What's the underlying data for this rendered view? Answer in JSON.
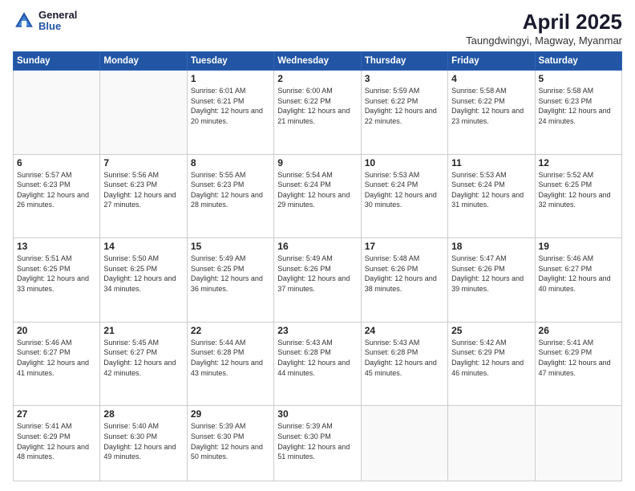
{
  "header": {
    "logo_general": "General",
    "logo_blue": "Blue",
    "title": "April 2025",
    "location": "Taungdwingyi, Magway, Myanmar"
  },
  "weekdays": [
    "Sunday",
    "Monday",
    "Tuesday",
    "Wednesday",
    "Thursday",
    "Friday",
    "Saturday"
  ],
  "weeks": [
    [
      {
        "day": "",
        "sunrise": "",
        "sunset": "",
        "daylight": ""
      },
      {
        "day": "",
        "sunrise": "",
        "sunset": "",
        "daylight": ""
      },
      {
        "day": "1",
        "sunrise": "Sunrise: 6:01 AM",
        "sunset": "Sunset: 6:21 PM",
        "daylight": "Daylight: 12 hours and 20 minutes."
      },
      {
        "day": "2",
        "sunrise": "Sunrise: 6:00 AM",
        "sunset": "Sunset: 6:22 PM",
        "daylight": "Daylight: 12 hours and 21 minutes."
      },
      {
        "day": "3",
        "sunrise": "Sunrise: 5:59 AM",
        "sunset": "Sunset: 6:22 PM",
        "daylight": "Daylight: 12 hours and 22 minutes."
      },
      {
        "day": "4",
        "sunrise": "Sunrise: 5:58 AM",
        "sunset": "Sunset: 6:22 PM",
        "daylight": "Daylight: 12 hours and 23 minutes."
      },
      {
        "day": "5",
        "sunrise": "Sunrise: 5:58 AM",
        "sunset": "Sunset: 6:23 PM",
        "daylight": "Daylight: 12 hours and 24 minutes."
      }
    ],
    [
      {
        "day": "6",
        "sunrise": "Sunrise: 5:57 AM",
        "sunset": "Sunset: 6:23 PM",
        "daylight": "Daylight: 12 hours and 26 minutes."
      },
      {
        "day": "7",
        "sunrise": "Sunrise: 5:56 AM",
        "sunset": "Sunset: 6:23 PM",
        "daylight": "Daylight: 12 hours and 27 minutes."
      },
      {
        "day": "8",
        "sunrise": "Sunrise: 5:55 AM",
        "sunset": "Sunset: 6:23 PM",
        "daylight": "Daylight: 12 hours and 28 minutes."
      },
      {
        "day": "9",
        "sunrise": "Sunrise: 5:54 AM",
        "sunset": "Sunset: 6:24 PM",
        "daylight": "Daylight: 12 hours and 29 minutes."
      },
      {
        "day": "10",
        "sunrise": "Sunrise: 5:53 AM",
        "sunset": "Sunset: 6:24 PM",
        "daylight": "Daylight: 12 hours and 30 minutes."
      },
      {
        "day": "11",
        "sunrise": "Sunrise: 5:53 AM",
        "sunset": "Sunset: 6:24 PM",
        "daylight": "Daylight: 12 hours and 31 minutes."
      },
      {
        "day": "12",
        "sunrise": "Sunrise: 5:52 AM",
        "sunset": "Sunset: 6:25 PM",
        "daylight": "Daylight: 12 hours and 32 minutes."
      }
    ],
    [
      {
        "day": "13",
        "sunrise": "Sunrise: 5:51 AM",
        "sunset": "Sunset: 6:25 PM",
        "daylight": "Daylight: 12 hours and 33 minutes."
      },
      {
        "day": "14",
        "sunrise": "Sunrise: 5:50 AM",
        "sunset": "Sunset: 6:25 PM",
        "daylight": "Daylight: 12 hours and 34 minutes."
      },
      {
        "day": "15",
        "sunrise": "Sunrise: 5:49 AM",
        "sunset": "Sunset: 6:25 PM",
        "daylight": "Daylight: 12 hours and 36 minutes."
      },
      {
        "day": "16",
        "sunrise": "Sunrise: 5:49 AM",
        "sunset": "Sunset: 6:26 PM",
        "daylight": "Daylight: 12 hours and 37 minutes."
      },
      {
        "day": "17",
        "sunrise": "Sunrise: 5:48 AM",
        "sunset": "Sunset: 6:26 PM",
        "daylight": "Daylight: 12 hours and 38 minutes."
      },
      {
        "day": "18",
        "sunrise": "Sunrise: 5:47 AM",
        "sunset": "Sunset: 6:26 PM",
        "daylight": "Daylight: 12 hours and 39 minutes."
      },
      {
        "day": "19",
        "sunrise": "Sunrise: 5:46 AM",
        "sunset": "Sunset: 6:27 PM",
        "daylight": "Daylight: 12 hours and 40 minutes."
      }
    ],
    [
      {
        "day": "20",
        "sunrise": "Sunrise: 5:46 AM",
        "sunset": "Sunset: 6:27 PM",
        "daylight": "Daylight: 12 hours and 41 minutes."
      },
      {
        "day": "21",
        "sunrise": "Sunrise: 5:45 AM",
        "sunset": "Sunset: 6:27 PM",
        "daylight": "Daylight: 12 hours and 42 minutes."
      },
      {
        "day": "22",
        "sunrise": "Sunrise: 5:44 AM",
        "sunset": "Sunset: 6:28 PM",
        "daylight": "Daylight: 12 hours and 43 minutes."
      },
      {
        "day": "23",
        "sunrise": "Sunrise: 5:43 AM",
        "sunset": "Sunset: 6:28 PM",
        "daylight": "Daylight: 12 hours and 44 minutes."
      },
      {
        "day": "24",
        "sunrise": "Sunrise: 5:43 AM",
        "sunset": "Sunset: 6:28 PM",
        "daylight": "Daylight: 12 hours and 45 minutes."
      },
      {
        "day": "25",
        "sunrise": "Sunrise: 5:42 AM",
        "sunset": "Sunset: 6:29 PM",
        "daylight": "Daylight: 12 hours and 46 minutes."
      },
      {
        "day": "26",
        "sunrise": "Sunrise: 5:41 AM",
        "sunset": "Sunset: 6:29 PM",
        "daylight": "Daylight: 12 hours and 47 minutes."
      }
    ],
    [
      {
        "day": "27",
        "sunrise": "Sunrise: 5:41 AM",
        "sunset": "Sunset: 6:29 PM",
        "daylight": "Daylight: 12 hours and 48 minutes."
      },
      {
        "day": "28",
        "sunrise": "Sunrise: 5:40 AM",
        "sunset": "Sunset: 6:30 PM",
        "daylight": "Daylight: 12 hours and 49 minutes."
      },
      {
        "day": "29",
        "sunrise": "Sunrise: 5:39 AM",
        "sunset": "Sunset: 6:30 PM",
        "daylight": "Daylight: 12 hours and 50 minutes."
      },
      {
        "day": "30",
        "sunrise": "Sunrise: 5:39 AM",
        "sunset": "Sunset: 6:30 PM",
        "daylight": "Daylight: 12 hours and 51 minutes."
      },
      {
        "day": "",
        "sunrise": "",
        "sunset": "",
        "daylight": ""
      },
      {
        "day": "",
        "sunrise": "",
        "sunset": "",
        "daylight": ""
      },
      {
        "day": "",
        "sunrise": "",
        "sunset": "",
        "daylight": ""
      }
    ]
  ]
}
